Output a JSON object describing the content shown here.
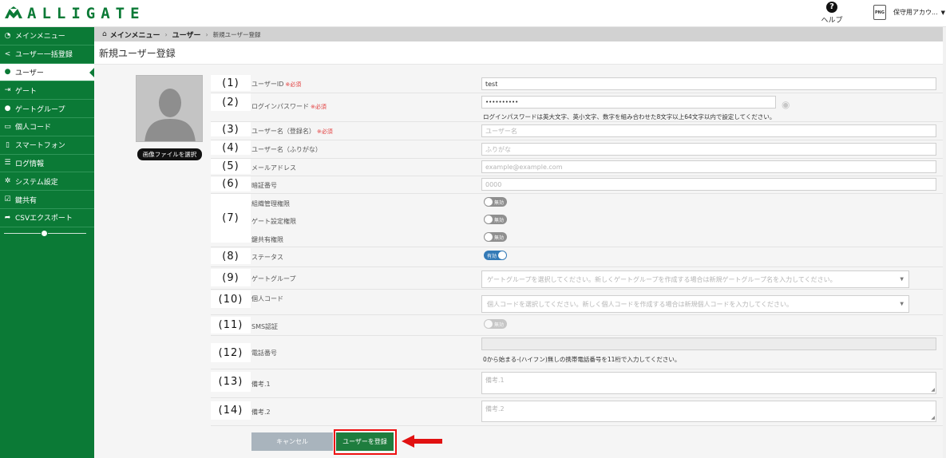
{
  "app": {
    "logo_text": "ALLIGATE"
  },
  "header": {
    "help_label": "ヘルプ",
    "account_name": "保守用アカウ...",
    "file_icon_text": "PNG"
  },
  "sidebar": {
    "items": [
      {
        "label": "メインメニュー",
        "icon": "dashboard-icon"
      },
      {
        "label": "ユーザー一括登録",
        "icon": "share-icon"
      },
      {
        "label": "ユーザー",
        "icon": "user-icon"
      },
      {
        "label": "ゲート",
        "icon": "sign-in-icon"
      },
      {
        "label": "ゲートグループ",
        "icon": "users-icon"
      },
      {
        "label": "個人コード",
        "icon": "card-icon"
      },
      {
        "label": "スマートフォン",
        "icon": "mobile-icon"
      },
      {
        "label": "ログ情報",
        "icon": "list-icon"
      },
      {
        "label": "システム設定",
        "icon": "gear-icon"
      },
      {
        "label": "鍵共有",
        "icon": "check-square-icon"
      },
      {
        "label": "CSVエクスポート",
        "icon": "share-arrow-icon"
      }
    ],
    "active_index": 2
  },
  "breadcrumb": {
    "home": "メインメニュー",
    "section": "ユーザー",
    "current": "新規ユーザー登録"
  },
  "page": {
    "title": "新規ユーザー登録"
  },
  "photo": {
    "select_button": "画像ファイルを選択"
  },
  "form": {
    "required_mark": "※必須",
    "user_id": {
      "num": "(1)",
      "label": "ユーザーID",
      "value": "test"
    },
    "password": {
      "num": "(2)",
      "label": "ログインパスワード",
      "value": "••••••••••",
      "hint": "ログインパスワードは英大文字、英小文字、数字を組み合わせた8文字以上64文字以内で設定してください。"
    },
    "user_name": {
      "num": "(3)",
      "label": "ユーザー名（登録名）",
      "placeholder": "ユーザー名"
    },
    "furigana": {
      "num": "(4)",
      "label": "ユーザー名（ふりがな）",
      "placeholder": "ふりがな"
    },
    "email": {
      "num": "(5)",
      "label": "メールアドレス",
      "placeholder": "example@example.com"
    },
    "pin": {
      "num": "(6)",
      "label": "暗証番号",
      "placeholder": "0000"
    },
    "permissions": {
      "num": "(7)",
      "items": [
        {
          "label": "組織管理権限",
          "state": "無効"
        },
        {
          "label": "ゲート設定権限",
          "state": "無効"
        },
        {
          "label": "鍵共有権限",
          "state": "無効"
        }
      ]
    },
    "status": {
      "num": "(8)",
      "label": "ステータス",
      "state": "有効"
    },
    "gate_group": {
      "num": "(9)",
      "label": "ゲートグループ",
      "placeholder": "ゲートグループを選択してください。新しくゲートグループを作成する場合は新規ゲートグループ名を入力してください。"
    },
    "personal_code": {
      "num": "(10)",
      "label": "個人コード",
      "placeholder": "個人コードを選択してください。新しく個人コードを作成する場合は新規個人コードを入力してください。"
    },
    "sms": {
      "num": "(11)",
      "label": "SMS認証",
      "state": "無効"
    },
    "phone": {
      "num": "(12)",
      "label": "電話番号",
      "hint": "0から始まる-(ハイフン)無しの携帯電話番号を11桁で入力してください。"
    },
    "note1": {
      "num": "(13)",
      "label": "備考.1",
      "placeholder": "備考.1"
    },
    "note2": {
      "num": "(14)",
      "label": "備考.2",
      "placeholder": "備考.2"
    }
  },
  "buttons": {
    "cancel": "キャンセル",
    "save": "ユーザーを登録"
  },
  "colors": {
    "brand_green": "#0b7a36",
    "save_green": "#1e7d3e",
    "highlight_red": "#e11111",
    "toggle_on": "#337ab7"
  }
}
